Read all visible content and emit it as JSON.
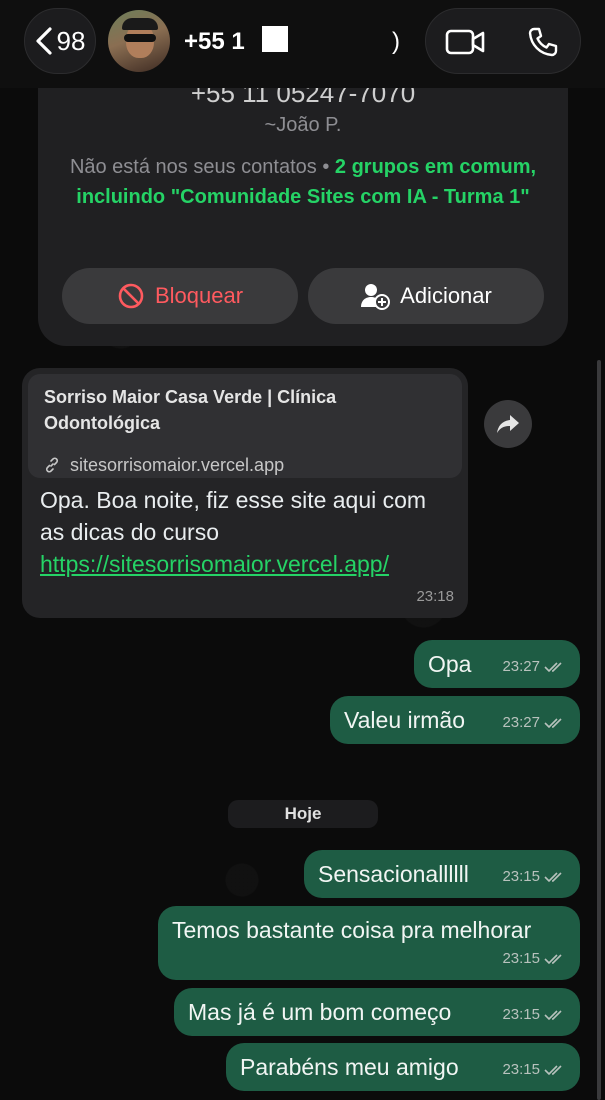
{
  "header": {
    "unread_count": "98",
    "contact_name": "+55 1",
    "contact_name_tail": ")"
  },
  "contact_card": {
    "phone_partial": "+55 11 05247-7070",
    "alias": "~João P.",
    "not_in_contacts": "Não está nos seus contatos",
    "separator": "•",
    "groups_text": "2 grupos em comum, incluindo \"Comunidade Sites com IA - Turma 1\"",
    "block_label": "Bloquear",
    "add_label": "Adicionar"
  },
  "messages": {
    "link": {
      "preview_title": "Sorriso Maior Casa Verde | Clínica Odontológica",
      "preview_url": "sitesorrisomaior.vercel.app",
      "text": "Opa. Boa noite, fiz esse site aqui com as dicas do curso",
      "link": "https://sitesorrisomaior.vercel.app/",
      "time": "23:18"
    },
    "m1": {
      "text": "Opa",
      "time": "23:27"
    },
    "m2": {
      "text": "Valeu irmão",
      "time": "23:27"
    },
    "date_chip": "Hoje",
    "m3": {
      "text": "Sensacionallllll",
      "time": "23:15"
    },
    "m4": {
      "text": "Temos bastante coisa pra melhorar",
      "time": "23:15"
    },
    "m5": {
      "text": "Mas já é um bom começo",
      "time": "23:15"
    },
    "m6": {
      "text": "Parabéns meu amigo",
      "time": "23:15"
    }
  },
  "colors": {
    "outgoing_bubble": "#1e5c44",
    "incoming_bubble": "#242426",
    "accent_green": "#25d366",
    "block_red": "#ff5a5f"
  }
}
